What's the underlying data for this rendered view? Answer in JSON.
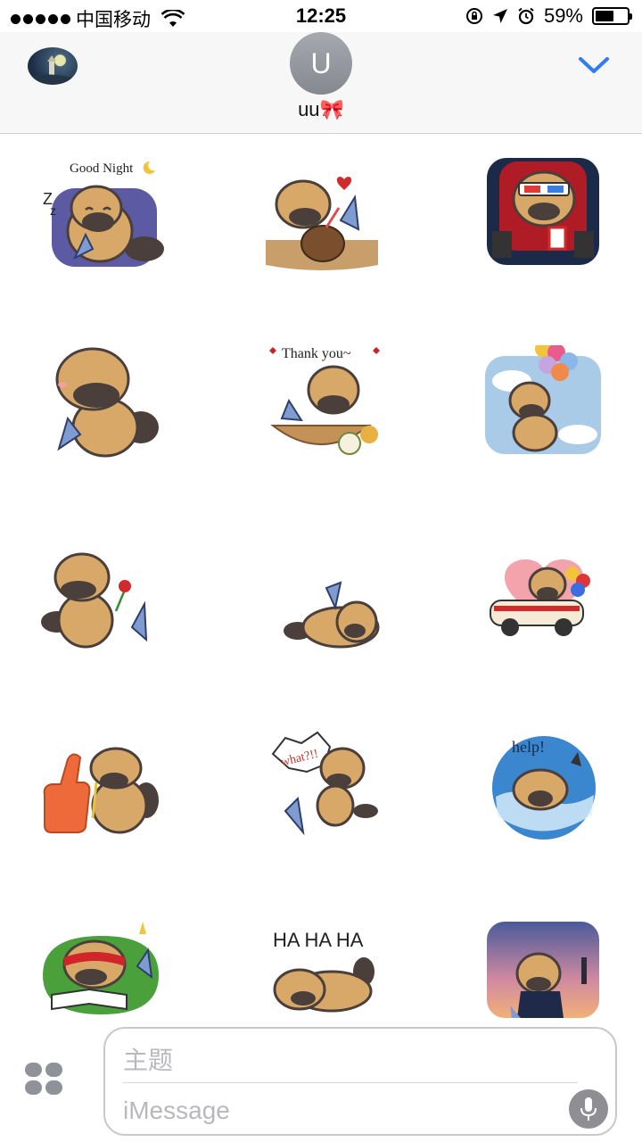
{
  "status_bar": {
    "carrier": "中国移动",
    "time": "12:25",
    "battery_percent": "59%",
    "battery_level": 0.59
  },
  "header": {
    "avatar_initial": "U",
    "contact_name": "uu🎀",
    "app_icon": "lighthouse-app-icon",
    "collapse_icon": "chevron-down-icon"
  },
  "stickers": [
    {
      "name": "sticker-good-night",
      "caption": "Good Night"
    },
    {
      "name": "sticker-coconut-drink",
      "caption": ""
    },
    {
      "name": "sticker-3d-cinema",
      "caption": ""
    },
    {
      "name": "sticker-hug-friend",
      "caption": ""
    },
    {
      "name": "sticker-thank-you",
      "caption": "Thank you~"
    },
    {
      "name": "sticker-balloons-sky",
      "caption": ""
    },
    {
      "name": "sticker-give-flower",
      "caption": ""
    },
    {
      "name": "sticker-lying-down",
      "caption": ""
    },
    {
      "name": "sticker-car-balloons",
      "caption": ""
    },
    {
      "name": "sticker-thumbs-up",
      "caption": ""
    },
    {
      "name": "sticker-what",
      "caption": "what?!!"
    },
    {
      "name": "sticker-help",
      "caption": "help!"
    },
    {
      "name": "sticker-studying",
      "caption": ""
    },
    {
      "name": "sticker-ha-ha-ha",
      "caption": "HA HA HA"
    },
    {
      "name": "sticker-sunset-suit",
      "caption": ""
    }
  ],
  "compose": {
    "subject_placeholder": "主题",
    "message_placeholder": "iMessage",
    "apps_icon": "app-drawer-icon",
    "mic_icon": "microphone-icon"
  },
  "colors": {
    "accent": "#2f7cf6",
    "platypus": "#d8a868",
    "bill": "#4a3f3b"
  }
}
